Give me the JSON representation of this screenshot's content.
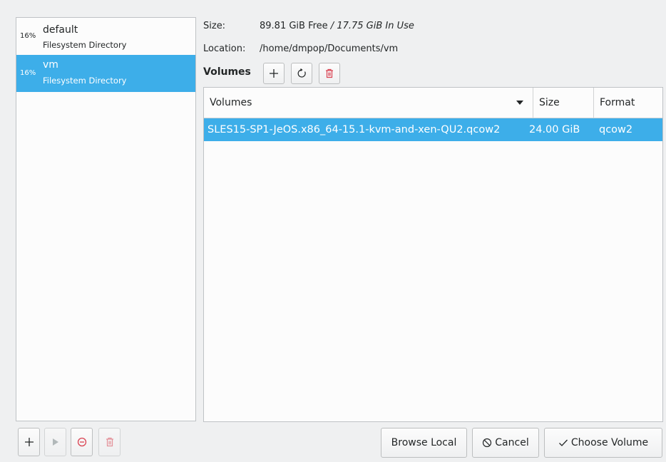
{
  "pools": [
    {
      "percent": "16%",
      "name": "default",
      "type": "Filesystem Directory",
      "selected": false
    },
    {
      "percent": "16%",
      "name": "vm",
      "type": "Filesystem Directory",
      "selected": true
    }
  ],
  "info": {
    "size_label": "Size:",
    "size_free": "89.81 GiB Free",
    "size_separator": " / ",
    "size_in_use": "17.75 GiB In Use",
    "location_label": "Location:",
    "location_value": "/home/dmpop/Documents/vm"
  },
  "volumes_toolbar": {
    "label": "Volumes",
    "icons": [
      "add-icon",
      "refresh-icon",
      "delete-icon"
    ]
  },
  "volume_table": {
    "columns": [
      "Volumes",
      "Size",
      "Format"
    ],
    "rows": [
      {
        "name": "SLES15-SP1-JeOS.x86_64-15.1-kvm-and-xen-QU2.qcow2",
        "size": "24.00 GiB",
        "format": "qcow2",
        "selected": true
      }
    ]
  },
  "pool_toolbar": {
    "icons": [
      "add-icon",
      "play-icon",
      "stop-icon",
      "delete-icon"
    ]
  },
  "buttons": {
    "browse_local": "Browse Local",
    "cancel": "Cancel",
    "choose_volume": "Choose Volume"
  },
  "colors": {
    "selection": "#3daee9",
    "delete_red": "#da4453",
    "background": "#eff0f1"
  }
}
